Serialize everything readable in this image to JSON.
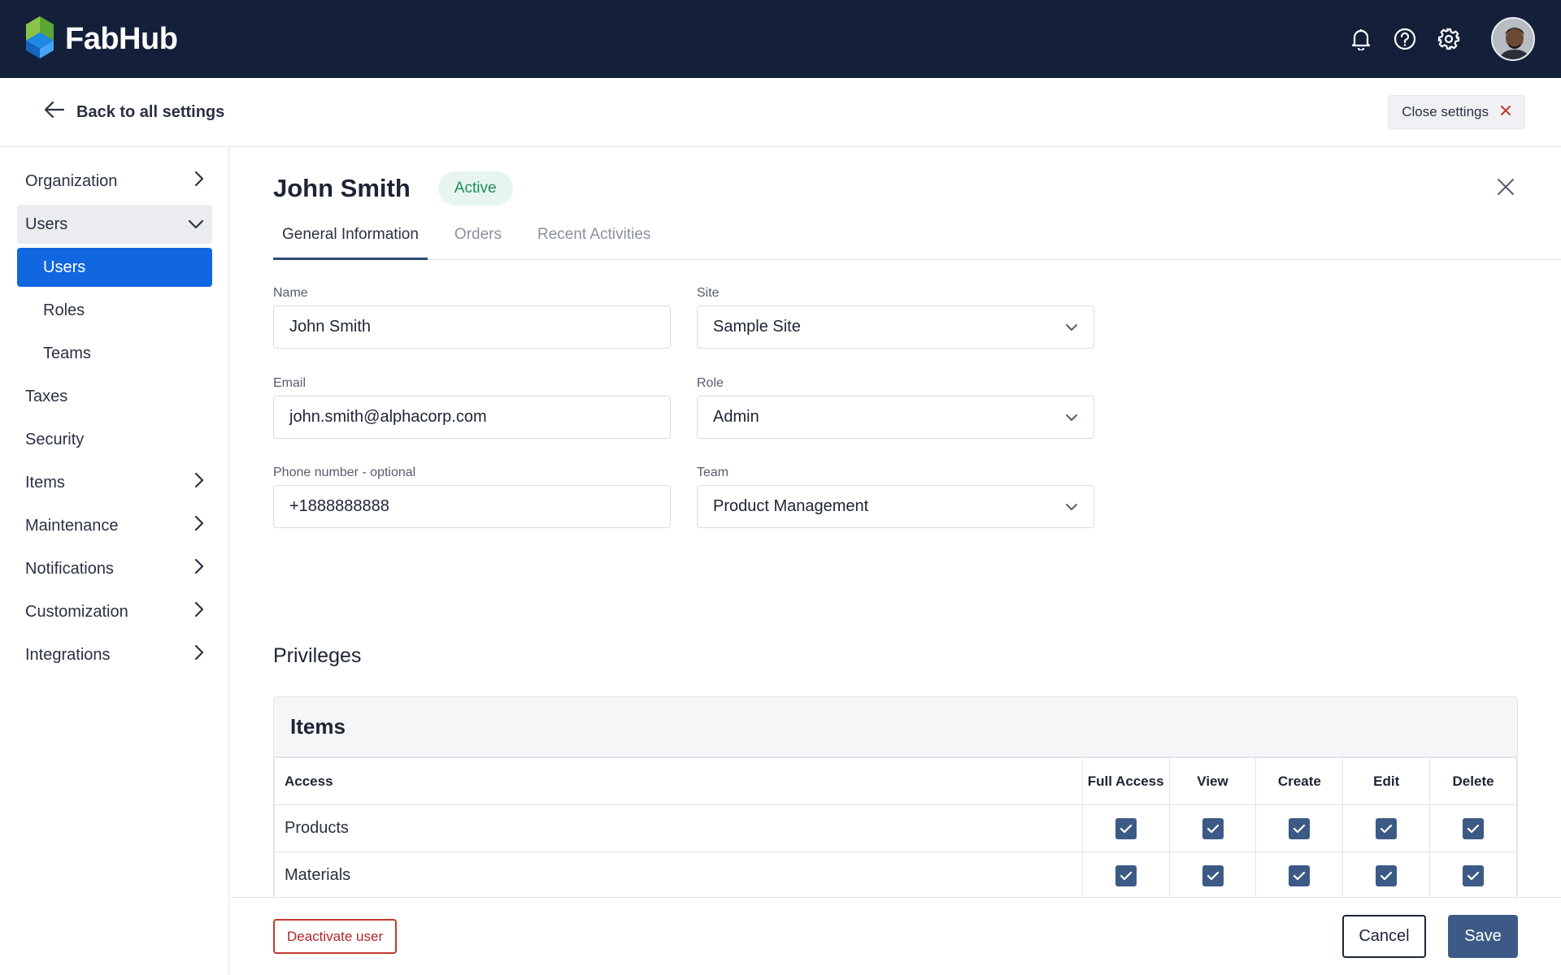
{
  "app": {
    "brand": "FabHub"
  },
  "topbar": {
    "icons": [
      "bell-icon",
      "help-icon",
      "gear-icon"
    ]
  },
  "settings_bar": {
    "back_label": "Back to all settings",
    "close_label": "Close settings"
  },
  "sidebar": {
    "items": [
      {
        "label": "Organization",
        "chevron": "right"
      },
      {
        "label": "Users",
        "chevron": "down",
        "expanded": true
      },
      {
        "label": "Users",
        "sub": true,
        "active": true
      },
      {
        "label": "Roles",
        "sub": true
      },
      {
        "label": "Teams",
        "sub": true
      },
      {
        "label": "Taxes"
      },
      {
        "label": "Security"
      },
      {
        "label": "Items",
        "chevron": "right"
      },
      {
        "label": "Maintenance",
        "chevron": "right"
      },
      {
        "label": "Notifications",
        "chevron": "right"
      },
      {
        "label": "Customization",
        "chevron": "right"
      },
      {
        "label": "Integrations",
        "chevron": "right"
      }
    ]
  },
  "user": {
    "name": "John Smith",
    "status": "Active"
  },
  "tabs": [
    {
      "label": "General Information",
      "active": true
    },
    {
      "label": "Orders"
    },
    {
      "label": "Recent Activities"
    }
  ],
  "form": {
    "name": {
      "label": "Name",
      "value": "John Smith"
    },
    "email": {
      "label": "Email",
      "value": "john.smith@alphacorp.com"
    },
    "phone": {
      "label": "Phone number - optional",
      "value": "+1888888888"
    },
    "site": {
      "label": "Site",
      "value": "Sample Site"
    },
    "role": {
      "label": "Role",
      "value": "Admin"
    },
    "team": {
      "label": "Team",
      "value": "Product Management"
    }
  },
  "privileges": {
    "title": "Privileges",
    "card_title": "Items",
    "columns": [
      "Access",
      "Full Access",
      "View",
      "Create",
      "Edit",
      "Delete"
    ],
    "rows": [
      {
        "name": "Products",
        "checks": [
          true,
          true,
          true,
          true,
          true
        ]
      },
      {
        "name": "Materials",
        "checks": [
          true,
          true,
          true,
          true,
          true
        ]
      }
    ]
  },
  "footer": {
    "deactivate_label": "Deactivate user",
    "cancel_label": "Cancel",
    "save_label": "Save"
  },
  "colors": {
    "topbar": "#142039",
    "accent": "#1167e0",
    "primary_button": "#3c5a85",
    "danger": "#b0262a",
    "success": "#1f8c58"
  }
}
